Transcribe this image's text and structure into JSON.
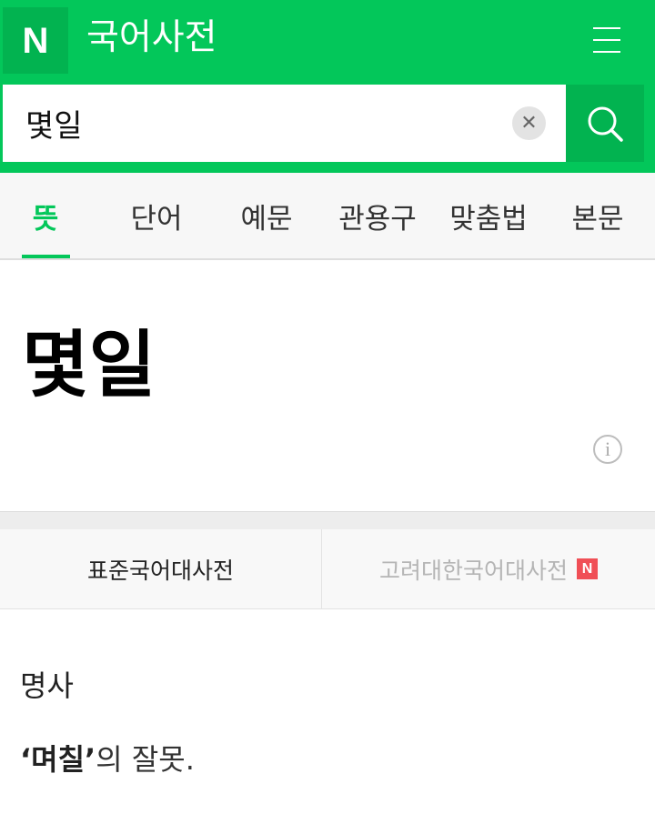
{
  "header": {
    "logo_letter": "N",
    "title": "국어사전",
    "menu_icon": "hamburger-menu-icon",
    "bg_color": "#03c75a"
  },
  "search": {
    "value": "몇일",
    "clear_icon": "clear-icon",
    "search_icon": "search-icon"
  },
  "tabs": [
    {
      "label": "뜻",
      "active": true
    },
    {
      "label": "단어"
    },
    {
      "label": "예문"
    },
    {
      "label": "관용구"
    },
    {
      "label": "맞춤법"
    },
    {
      "label": "본문"
    }
  ],
  "entry": {
    "headword": "몇일",
    "info_icon": "info-icon"
  },
  "dictionaries": [
    {
      "label": "표준국어대사전",
      "active": true
    },
    {
      "label": "고려대한국어대사전",
      "badge": "N",
      "badge_color": "#f04f56"
    }
  ],
  "definition": {
    "part_of_speech": "명사",
    "quote_open": "‘",
    "term": "며칠",
    "quote_close": "’",
    "suffix": "의 잘못."
  }
}
